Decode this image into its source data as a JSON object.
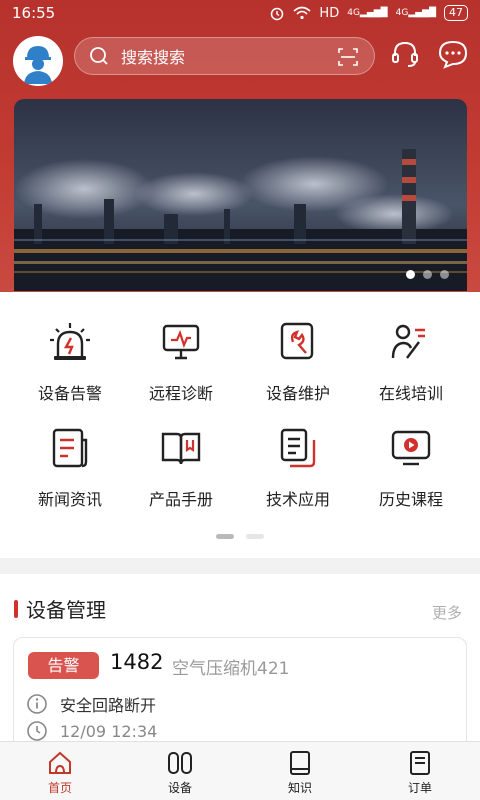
{
  "status_bar": {
    "time": "16:55",
    "network": "HD",
    "signal1": "4G",
    "signal2": "4G",
    "battery": "47"
  },
  "header": {
    "search_placeholder": "搜索搜索"
  },
  "banner": {
    "dots": 3,
    "active_dot": 0
  },
  "grid": {
    "items": [
      {
        "label": "设备告警",
        "icon": "alarm-light-icon"
      },
      {
        "label": "远程诊断",
        "icon": "monitor-diagnosis-icon"
      },
      {
        "label": "设备维护",
        "icon": "wrench-icon"
      },
      {
        "label": "在线培训",
        "icon": "teacher-icon"
      },
      {
        "label": "新闻资讯",
        "icon": "news-icon"
      },
      {
        "label": "产品手册",
        "icon": "book-icon"
      },
      {
        "label": "技术应用",
        "icon": "documents-icon"
      },
      {
        "label": "历史课程",
        "icon": "video-icon"
      }
    ],
    "page_active": 0
  },
  "device_section": {
    "title": "设备管理",
    "more": "更多",
    "card": {
      "badge": "告警",
      "number": "1482",
      "name": "空气压缩机421",
      "info": "安全回路断开",
      "datetime": "12/09  12:34"
    }
  },
  "tabbar": {
    "items": [
      {
        "label": "首页",
        "icon": "home-icon",
        "active": true
      },
      {
        "label": "设备",
        "icon": "device-icon",
        "active": false
      },
      {
        "label": "知识",
        "icon": "knowledge-icon",
        "active": false
      },
      {
        "label": "订单",
        "icon": "order-icon",
        "active": false
      }
    ]
  },
  "colors": {
    "brand": "#c0392b",
    "badge": "#d9534f"
  }
}
